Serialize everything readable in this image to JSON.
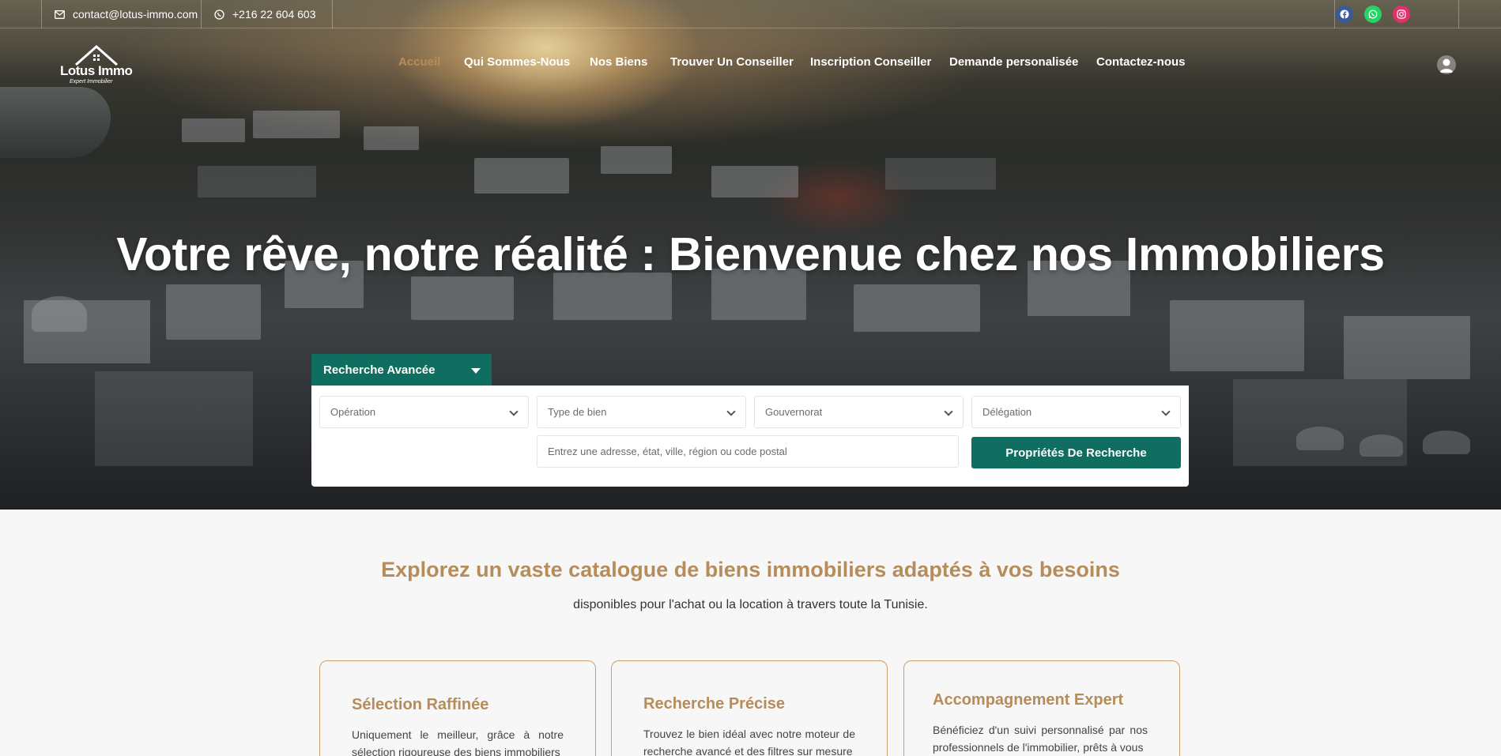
{
  "topbar": {
    "email": "contact@lotus-immo.com",
    "phone": "+216 22 604 603",
    "socials": [
      {
        "name": "facebook",
        "color": "#3b5998"
      },
      {
        "name": "whatsapp",
        "color": "#25d366"
      },
      {
        "name": "instagram",
        "color": "#e1306c"
      }
    ]
  },
  "logo": {
    "name": "Lotus Immo",
    "tagline": "Expert Immobilier"
  },
  "nav": {
    "items": [
      "Accueil",
      "Qui Sommes-Nous",
      "Nos Biens",
      "Trouver Un Conseiller",
      "Inscription Conseiller",
      "Demande personalisée",
      "Contactez-nous"
    ],
    "active_index": 0
  },
  "hero": {
    "title": "Votre rêve, notre réalité : Bienvenue chez nos Immobiliers"
  },
  "search": {
    "tab_label": "Recherche Avancée",
    "selects": [
      "Opération",
      "Type de bien",
      "Gouvernorat",
      "Délégation"
    ],
    "address_placeholder": "Entrez une adresse, état, ville, région ou code postal",
    "button_label": "Propriétés De Recherche"
  },
  "section": {
    "title": "Explorez un vaste catalogue de biens immobiliers adaptés à vos besoins",
    "subtitle": "disponibles pour l'achat ou la location à travers toute la Tunisie."
  },
  "cards": [
    {
      "title": "Sélection Raffinée",
      "text": "Uniquement le meilleur, grâce à notre sélection rigoureuse des biens immobiliers"
    },
    {
      "title": "Recherche Précise",
      "text": "Trouvez le bien idéal avec notre moteur de recherche avancé et des filtres sur mesure"
    },
    {
      "title": "Accompagnement Expert",
      "text": "Bénéficiez d'un suivi personnalisé par nos professionnels de l'immobilier, prêts à vous"
    }
  ],
  "colors": {
    "accent": "#b68c5a",
    "primary": "#0f6e5f"
  }
}
